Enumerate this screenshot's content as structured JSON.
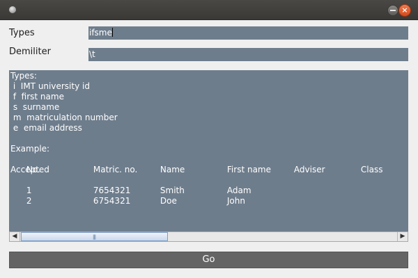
{
  "window": {
    "title": "",
    "close_glyph": "×"
  },
  "form": {
    "types_label": "Types",
    "types_value": "ifsme",
    "delimiter_label": "Demiliter",
    "delimiter_value": "\\t"
  },
  "textarea": {
    "lines": [
      "Types:",
      " i  IMT university id",
      " f  first name",
      " s  surname",
      " m  matriculation number",
      " e  email address",
      "",
      "Example:"
    ],
    "table_headers": [
      "No.",
      "Matric. no.",
      "Name",
      "First name",
      "Adviser",
      "Class"
    ],
    "wrapped_header": "Accepted",
    "rows": [
      [
        "1",
        "7654321",
        "Smith",
        "Adam"
      ],
      [
        "2",
        "6754321",
        "Doe",
        "John"
      ]
    ]
  },
  "scrollbar": {
    "left_arrow": "◀",
    "right_arrow": "▶",
    "grip": "|||"
  },
  "actions": {
    "go_label": "Go"
  },
  "colors": {
    "field_bg": "#6e7d8c",
    "button_bg": "#646464",
    "titlebar_bg": "#3f3e3a",
    "close_button": "#e0561f"
  }
}
